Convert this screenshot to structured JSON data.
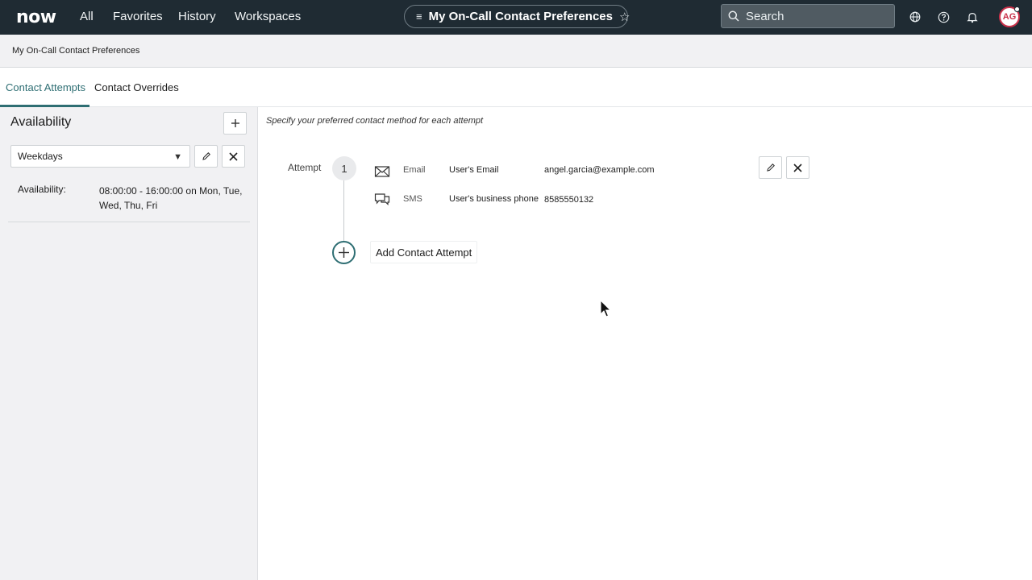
{
  "topnav": {
    "logo": "now",
    "items": [
      "All",
      "Favorites",
      "History",
      "Workspaces"
    ],
    "title": "My On-Call Contact Preferences",
    "search_placeholder": "Search",
    "avatar_initials": "AG"
  },
  "breadcrumb": "My On-Call Contact Preferences",
  "tabs": [
    "Contact Attempts",
    "Contact Overrides"
  ],
  "availability": {
    "title": "Availability",
    "selected": "Weekdays",
    "label": "Availability:",
    "value": "08:00:00 - 16:00:00 on Mon, Tue, Wed, Thu, Fri"
  },
  "contact": {
    "hint": "Specify your preferred contact method for each attempt",
    "attempt_label": "Attempt",
    "attempt_number": "1",
    "methods": [
      {
        "type": "Email",
        "source": "User's Email",
        "value": "angel.garcia@example.com",
        "icon": "envelope-icon"
      },
      {
        "type": "SMS",
        "source": "User's business phone",
        "value": "8585550132",
        "icon": "chat-icon"
      }
    ],
    "add_label": "Add Contact Attempt"
  },
  "colors": {
    "nav_bg": "#1f2b33",
    "accent": "#2e6e73",
    "panel_bg": "#f1f1f3",
    "avatar_ring": "#c9314a"
  }
}
